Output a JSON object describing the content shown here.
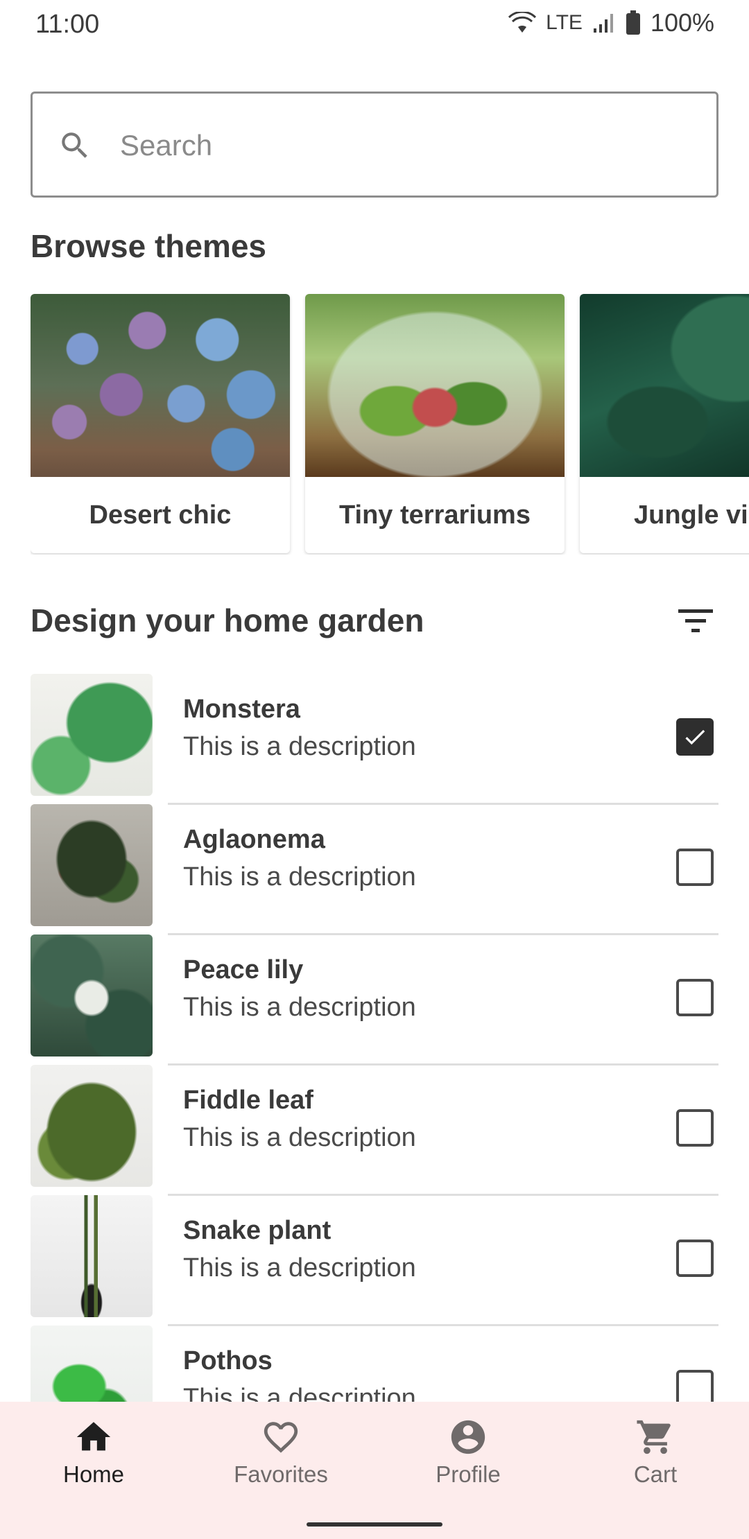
{
  "status_bar": {
    "time": "11:00",
    "network": "LTE",
    "battery": "100%"
  },
  "search": {
    "placeholder": "Search",
    "value": ""
  },
  "browse_section": {
    "title": "Browse themes",
    "themes": [
      {
        "label": "Desert chic"
      },
      {
        "label": "Tiny terrariums"
      },
      {
        "label": "Jungle vibes"
      }
    ]
  },
  "garden_section": {
    "title": "Design your home garden",
    "plants": [
      {
        "name": "Monstera",
        "description": "This is a description",
        "checked": true
      },
      {
        "name": "Aglaonema",
        "description": "This is a description",
        "checked": false
      },
      {
        "name": "Peace lily",
        "description": "This is a description",
        "checked": false
      },
      {
        "name": "Fiddle leaf",
        "description": "This is a description",
        "checked": false
      },
      {
        "name": "Snake plant",
        "description": "This is a description",
        "checked": false
      },
      {
        "name": "Pothos",
        "description": "This is a description",
        "checked": false
      }
    ]
  },
  "bottom_nav": {
    "items": [
      {
        "label": "Home",
        "icon": "home-icon",
        "active": true
      },
      {
        "label": "Favorites",
        "icon": "heart-icon",
        "active": false
      },
      {
        "label": "Profile",
        "icon": "account-icon",
        "active": false
      },
      {
        "label": "Cart",
        "icon": "cart-icon",
        "active": false
      }
    ]
  },
  "colors": {
    "nav_background": "#fdecec",
    "text_primary": "#3a3a3a",
    "checkbox_checked": "#2e2e2e"
  }
}
